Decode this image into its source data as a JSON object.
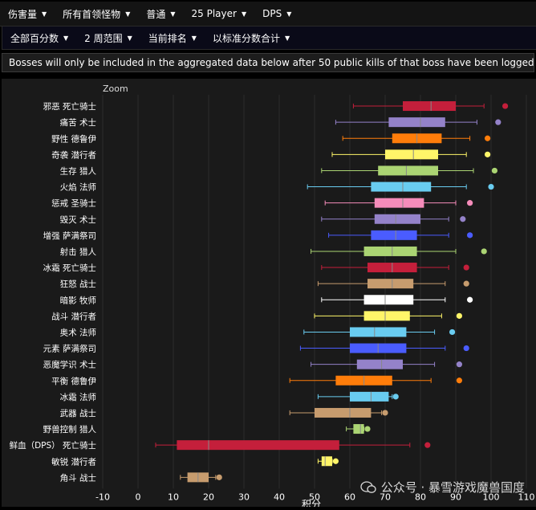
{
  "filters": {
    "metric": "伤害量",
    "bosses": "所有首领怪物",
    "difficulty": "普通",
    "size": "25 Player",
    "stat": "DPS",
    "percentile": "全部百分数",
    "time_range": "2 周范围",
    "ranking": "当前排名",
    "scoring": "以标准分数合计"
  },
  "notice": "Bosses will only be included in the aggregated data below after 50 public kills of that boss have been logged.",
  "zoom_label": "Zoom",
  "watermark": "公众号 · 暴雪游戏魔兽国度",
  "chart_data": {
    "type": "box",
    "xlabel": "积分",
    "xlim": [
      -10,
      110
    ],
    "xticks": [
      -10,
      0,
      10,
      20,
      30,
      40,
      50,
      60,
      70,
      80,
      90,
      100,
      110
    ],
    "grid": true,
    "rows": [
      {
        "label": "邪恶 死亡骑士",
        "color": "#c41f3b",
        "whisker_low": 61,
        "q1": 75,
        "median": 83,
        "q3": 90,
        "whisker_high": 98,
        "outlier": 104
      },
      {
        "label": "痛苦 术士",
        "color": "#9482c9",
        "whisker_low": 56,
        "q1": 71,
        "median": 80,
        "q3": 87,
        "whisker_high": 96,
        "outlier": 102
      },
      {
        "label": "野性 德鲁伊",
        "color": "#ff7d0a",
        "whisker_low": 58,
        "q1": 72,
        "median": 79,
        "q3": 86,
        "whisker_high": 94,
        "outlier": 99
      },
      {
        "label": "奇袭 潜行者",
        "color": "#fff569",
        "whisker_low": 55,
        "q1": 70,
        "median": 78,
        "q3": 85,
        "whisker_high": 93,
        "outlier": 99
      },
      {
        "label": "生存 猎人",
        "color": "#abd473",
        "whisker_low": 52,
        "q1": 68,
        "median": 76,
        "q3": 85,
        "whisker_high": 95,
        "outlier": 101
      },
      {
        "label": "火焰 法师",
        "color": "#69ccf0",
        "whisker_low": 48,
        "q1": 66,
        "median": 75,
        "q3": 83,
        "whisker_high": 93,
        "outlier": 100
      },
      {
        "label": "惩戒 圣骑士",
        "color": "#f58cba",
        "whisker_low": 53,
        "q1": 67,
        "median": 75,
        "q3": 81,
        "whisker_high": 90,
        "outlier": 94
      },
      {
        "label": "毁灭 术士",
        "color": "#9482c9",
        "whisker_low": 52,
        "q1": 67,
        "median": 73,
        "q3": 80,
        "whisker_high": 88,
        "outlier": 92
      },
      {
        "label": "增强 萨满祭司",
        "color": "#4a5cff",
        "whisker_low": 54,
        "q1": 66,
        "median": 73,
        "q3": 79,
        "whisker_high": 88,
        "outlier": 94
      },
      {
        "label": "射击 猎人",
        "color": "#abd473",
        "whisker_low": 49,
        "q1": 64,
        "median": 72,
        "q3": 79,
        "whisker_high": 90,
        "outlier": 98
      },
      {
        "label": "冰霜 死亡骑士",
        "color": "#c41f3b",
        "whisker_low": 52,
        "q1": 65,
        "median": 72,
        "q3": 79,
        "whisker_high": 88,
        "outlier": 93
      },
      {
        "label": "狂怒 战士",
        "color": "#c79c6e",
        "whisker_low": 51,
        "q1": 65,
        "median": 72,
        "q3": 78,
        "whisker_high": 87,
        "outlier": 93
      },
      {
        "label": "暗影 牧师",
        "color": "#ffffff",
        "whisker_low": 52,
        "q1": 64,
        "median": 70,
        "q3": 78,
        "whisker_high": 87,
        "outlier": 94
      },
      {
        "label": "战斗 潜行者",
        "color": "#fff569",
        "whisker_low": 50,
        "q1": 64,
        "median": 70,
        "q3": 77,
        "whisker_high": 86,
        "outlier": 91
      },
      {
        "label": "奥术 法师",
        "color": "#69ccf0",
        "whisker_low": 47,
        "q1": 60,
        "median": 67,
        "q3": 76,
        "whisker_high": 84,
        "outlier": 89
      },
      {
        "label": "元素 萨满祭司",
        "color": "#4a5cff",
        "whisker_low": 46,
        "q1": 60,
        "median": 68,
        "q3": 76,
        "whisker_high": 87,
        "outlier": 93
      },
      {
        "label": "恶魔学识 术士",
        "color": "#9482c9",
        "whisker_low": 49,
        "q1": 62,
        "median": 69,
        "q3": 75,
        "whisker_high": 84,
        "outlier": 91
      },
      {
        "label": "平衡 德鲁伊",
        "color": "#ff7d0a",
        "whisker_low": 43,
        "q1": 56,
        "median": 64,
        "q3": 72,
        "whisker_high": 83,
        "outlier": 91
      },
      {
        "label": "冰霜 法师",
        "color": "#69ccf0",
        "whisker_low": 51,
        "q1": 60,
        "median": 66,
        "q3": 71,
        "whisker_high": 72,
        "outlier": 73
      },
      {
        "label": "武器 战士",
        "color": "#c79c6e",
        "whisker_low": 43,
        "q1": 50,
        "median": 60,
        "q3": 66,
        "whisker_high": 69,
        "outlier": 70
      },
      {
        "label": "野兽控制 猎人",
        "color": "#abd473",
        "whisker_low": 59,
        "q1": 61,
        "median": 63,
        "q3": 64,
        "whisker_high": 64,
        "outlier": 65
      },
      {
        "label": "鲜血（DPS） 死亡骑士",
        "color": "#c41f3b",
        "whisker_low": 5,
        "q1": 11,
        "median": 20,
        "q3": 57,
        "whisker_high": 77,
        "outlier": 82
      },
      {
        "label": "敏锐 潜行者",
        "color": "#fff569",
        "whisker_low": 51,
        "q1": 52,
        "median": 53,
        "q3": 55,
        "whisker_high": 55,
        "outlier": 56
      },
      {
        "label": "角斗 战士",
        "color": "#c79c6e",
        "whisker_low": 12,
        "q1": 14,
        "median": 17,
        "q3": 20,
        "whisker_high": 22,
        "outlier": 23
      }
    ]
  }
}
